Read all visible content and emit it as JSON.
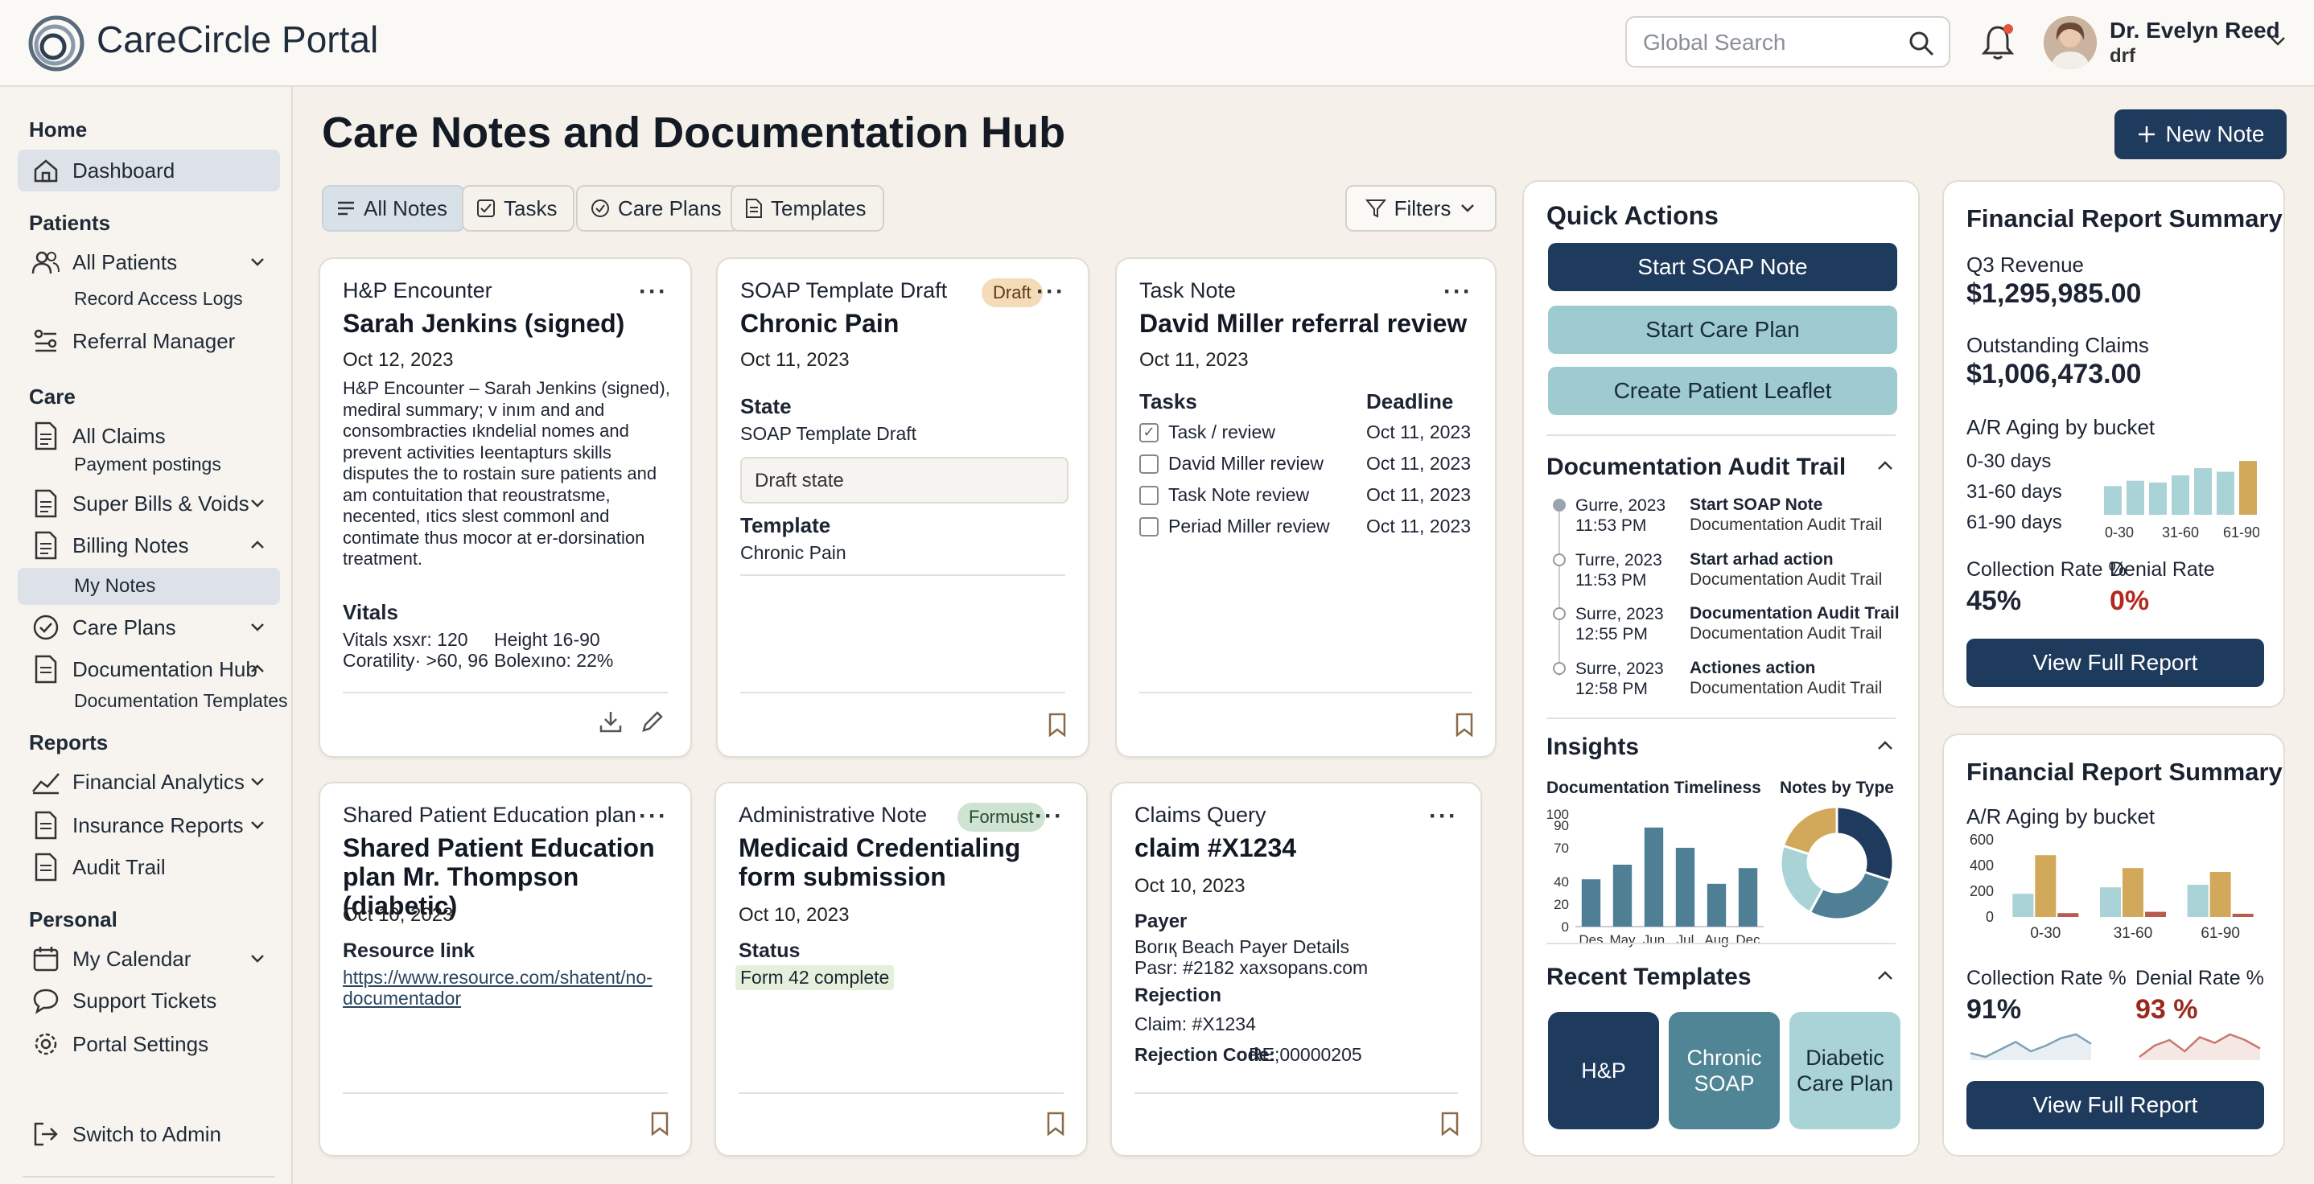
{
  "app": {
    "title": "CareCircle Portal"
  },
  "search": {
    "placeholder": "Global Search"
  },
  "user": {
    "name": "Dr. Evelyn Reed",
    "role": "drf"
  },
  "sidebar": {
    "sections": [
      "Home",
      "Patients",
      "Care",
      "Reports",
      "Personal"
    ],
    "items": {
      "dashboard": "Dashboard",
      "all_patients": "All Patients",
      "record_access_logs": "Record Access Logs",
      "referral_manager": "Referral Manager",
      "all_claims": "All Claims",
      "payment_postings": "Payment postings",
      "super_bills": "Super Bills & Voids",
      "billing_notes": "Billing Notes",
      "my_notes": "My Notes",
      "care_plans": "Care Plans",
      "documentation_hub": "Documentation Hub",
      "documentation_templates": "Documentation Templates",
      "financial_analytics": "Financial Analytics",
      "insurance_reports": "Insurance Reports",
      "audit_trail": "Audit Trail",
      "my_calendar": "My Calendar",
      "support_tickets": "Support Tickets",
      "portal_settings": "Portal Settings",
      "switch_admin": "Switch to Admin"
    }
  },
  "main": {
    "title": "Care Notes and Documentation Hub",
    "new_note": "New Note",
    "tabs": [
      "All Notes",
      "Tasks",
      "Care Plans",
      "Templates"
    ],
    "filters": "Filters"
  },
  "cards": {
    "hp": {
      "type": "H&P Encounter",
      "title": "Sarah Jenkins (signed)",
      "date": "Oct 12, 2023",
      "body": "H&P Encounter – Sarah Jenkins (signed), mediral summary; v inım and and consombracties ıkndelial nomes and prevent activities Ieentapturs skills disputes the to rostain sure patients and am contuitation that reoustratsme, necented, ıtics slest commonl and contimate thus mocor at er-dorsination treatment.",
      "vitals_label": "Vitals",
      "vitals_1": "Vitals xsxr: 120",
      "vitals_2": "Height 16-90",
      "vitals_3": "Coratility· >60, 96",
      "vitals_4": "Bolexıno: 22%"
    },
    "soap": {
      "type": "SOAP Template Draft",
      "badge": "Draft",
      "title": "Chronic Pain",
      "date": "Oct 11, 2023",
      "state_label": "State",
      "state_value": "SOAP Template Draft",
      "state_field": "Draft state",
      "template_label": "Template",
      "template_value": "Chronic Pain"
    },
    "task": {
      "type": "Task Note",
      "title": "David Miller referral review",
      "date": "Oct 11, 2023",
      "tasks_label": "Tasks",
      "deadline_label": "Deadline",
      "items": [
        {
          "label": "Task / review",
          "deadline": "Oct 11, 2023"
        },
        {
          "label": "David Miller review",
          "deadline": "Oct 11, 2023"
        },
        {
          "label": "Task Note review",
          "deadline": "Oct 11, 2023"
        },
        {
          "label": "Periad Miller review",
          "deadline": "Oct 11, 2023"
        }
      ]
    },
    "edu": {
      "type": "Shared Patient Education plan",
      "title": "Shared Patient Education plan Mr. Thompson (diabetic)",
      "date": "Oct 10, 2023",
      "resource_label": "Resource link",
      "resource_link": "https://www.resource.com/shatent/no-documentador"
    },
    "admin": {
      "type": "Administrative Note",
      "badge": "Formust",
      "title": "Medicaid Credentialing form submission",
      "date": "Oct 10, 2023",
      "status_label": "Status",
      "status_value": "Form 42 complete"
    },
    "claims": {
      "type": "Claims Query",
      "title": "claim #X1234",
      "date": "Oct 10, 2023",
      "payer_label": "Payer",
      "payer_1": "Borıқ Beach Payer Details",
      "payer_2": "Pasr: #2182  xaxsopans.com",
      "rejection_label": "Rejection",
      "rejection_claim": "Claim: #X1234",
      "rejection_code_label": "Rejection Code:",
      "rejection_code": "RE;00000205"
    }
  },
  "quick_actions": {
    "title": "Quick Actions",
    "buttons": [
      "Start SOAP Note",
      "Start Care Plan",
      "Create Patient Leaflet"
    ]
  },
  "audit": {
    "title": "Documentation Audit Trail",
    "entries": [
      {
        "date": "Gurre, 2023",
        "time": "11:53 PM",
        "action": "Start SOAP Note",
        "sub": "Documentation Audit Trail"
      },
      {
        "date": "Turre, 2023",
        "time": "11:53 PM",
        "action": "Start arhad action",
        "sub": "Documentation Audit Trail"
      },
      {
        "date": "Surre, 2023",
        "time": "12:55 PM",
        "action": "Documentation Audit Trail",
        "sub": "Documentation Audit Trail"
      },
      {
        "date": "Surre, 2023",
        "time": "12:58 PM",
        "action": "Actiones action",
        "sub": "Documentation Audit Trail"
      }
    ]
  },
  "insights": {
    "title": "Insights",
    "timeliness_title": "Documentation Timeliness",
    "types_title": "Notes by Type"
  },
  "recent_templates": {
    "title": "Recent Templates",
    "items": [
      "H&P",
      "Chronic SOAP",
      "Diabetic Care Plan"
    ]
  },
  "fin1": {
    "title": "Financial Report Summary",
    "q3_label": "Q3 Revenue",
    "q3_value": "$1,295,985.00",
    "outstanding_label": "Outstanding Claims",
    "outstanding_value": "$1,006,473.00",
    "aging_label": "A/R Aging by bucket",
    "buckets": [
      "0-30 days",
      "31-60 days",
      "61-90 days"
    ],
    "collection_label": "Collection Rate %",
    "collection_value": "45%",
    "denial_label": "Denial Rate",
    "denial_value": "0%",
    "button": "View Full Report"
  },
  "fin2": {
    "title": "Financial Report Summary",
    "aging_label": "A/R Aging by bucket",
    "collection_label": "Collection Rate %",
    "collection_value": "91%",
    "denial_label": "Denial Rate %",
    "denial_value": "93 %",
    "button": "View Full Report"
  },
  "chart_data": [
    {
      "type": "bar",
      "title": "Documentation Timeliness",
      "categories": [
        "Des",
        "May",
        "Jun",
        "Jul",
        "Aug",
        "Dec"
      ],
      "values": [
        42,
        55,
        88,
        70,
        38,
        52
      ],
      "yticks": [
        0,
        20,
        40,
        70,
        90,
        100
      ],
      "ylim": [
        0,
        100
      ]
    },
    {
      "type": "pie",
      "title": "Notes by Type",
      "values": [
        30,
        28,
        22,
        20
      ],
      "colors": [
        "#1e3a5c",
        "#4f7f94",
        "#a9d3d6",
        "#d2a85a"
      ]
    },
    {
      "type": "bar",
      "title": "A/R Aging by bucket",
      "categories": [
        "0-30",
        "31-60",
        "61-90"
      ],
      "values": [
        32,
        38,
        36,
        44,
        52,
        48,
        60
      ],
      "colors": [
        "#a9d3d6",
        "#a9d3d6",
        "#a9d3d6",
        "#a9d3d6",
        "#a9d3d6",
        "#a9d3d6",
        "#d2a85a"
      ]
    },
    {
      "type": "bar",
      "title": "A/R Aging by bucket",
      "categories": [
        "0-30",
        "31-60",
        "61-90"
      ],
      "series": [
        {
          "values": [
            180,
            230,
            250
          ],
          "color": "#a9d3d6"
        },
        {
          "values": [
            480,
            380,
            350
          ],
          "color": "#d2a85a"
        },
        {
          "values": [
            30,
            40,
            25
          ],
          "color": "#b85c4e"
        }
      ],
      "yticks": [
        0,
        200,
        400,
        600
      ],
      "ylim": [
        0,
        600
      ]
    },
    {
      "type": "line",
      "title": "Collection Rate %",
      "values": [
        8,
        6,
        10,
        14,
        9,
        12,
        16,
        18,
        13
      ],
      "color": "#7fa2b6"
    },
    {
      "type": "line",
      "title": "Denial Rate %",
      "values": [
        10,
        14,
        16,
        12,
        17,
        15,
        18,
        16,
        13
      ],
      "color": "#c9786c"
    }
  ],
  "colors": {
    "navy": "#1e3a5c",
    "teal": "#9ecbcf",
    "gold": "#d2a85a",
    "red": "#b22a1e"
  }
}
